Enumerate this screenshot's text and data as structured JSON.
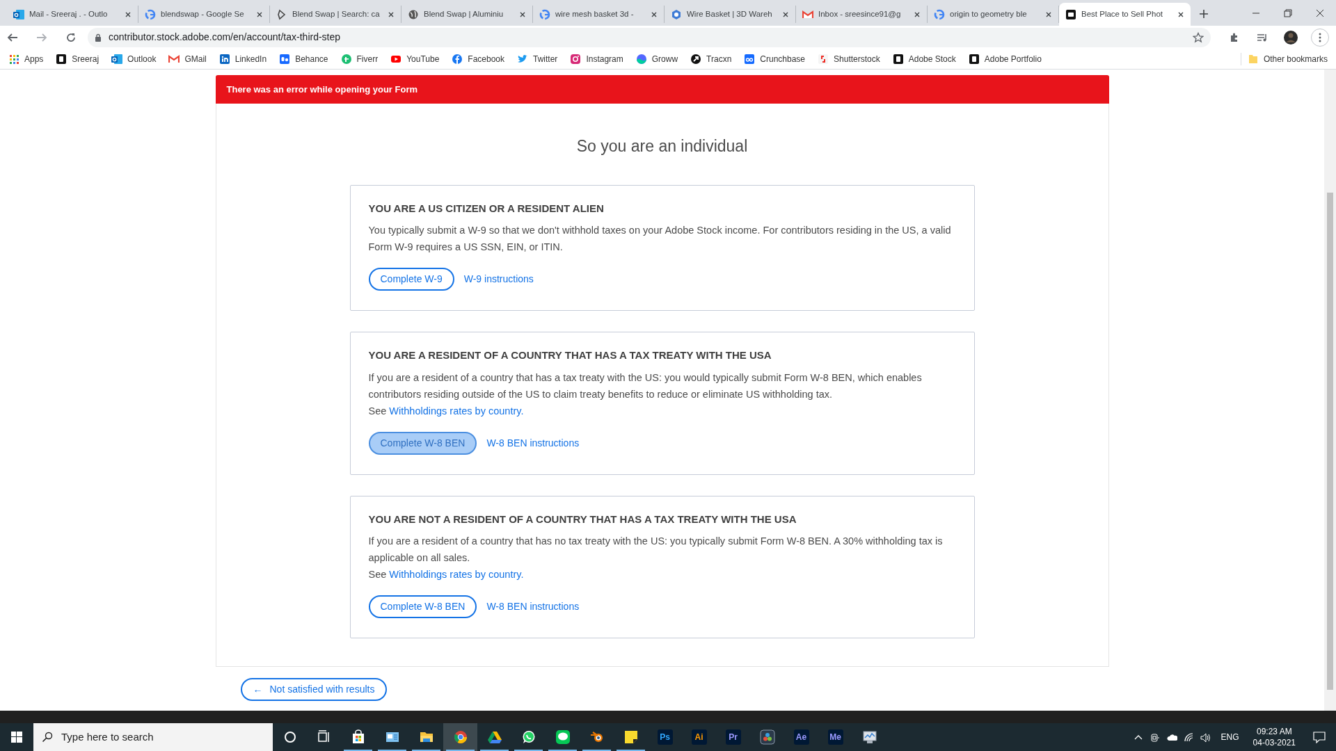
{
  "browser": {
    "tabs": [
      {
        "title": "Mail - Sreeraj . - Outlo",
        "selected": false
      },
      {
        "title": "blendswap - Google Se",
        "selected": false
      },
      {
        "title": "Blend Swap | Search: ca",
        "selected": false
      },
      {
        "title": "Blend Swap | Aluminiu",
        "selected": false
      },
      {
        "title": "wire mesh basket 3d -",
        "selected": false
      },
      {
        "title": "Wire Basket | 3D Wareh",
        "selected": false
      },
      {
        "title": "Inbox - sreesince91@g",
        "selected": false
      },
      {
        "title": "origin to geometry ble",
        "selected": false
      },
      {
        "title": "Best Place to Sell Phot",
        "selected": true
      }
    ],
    "url": "contributor.stock.adobe.com/en/account/tax-third-step",
    "bookmarks": [
      "Apps",
      "Sreeraj",
      "Outlook",
      "GMail",
      "LinkedIn",
      "Behance",
      "Fiverr",
      "YouTube",
      "Facebook",
      "Twitter",
      "Instagram",
      "Groww",
      "Tracxn",
      "Crunchbase",
      "Shutterstock",
      "Adobe Stock",
      "Adobe Portfolio"
    ],
    "other_bookmarks": "Other bookmarks"
  },
  "page": {
    "error": "There was an error while opening your Form",
    "heading": "So you are an individual",
    "options": [
      {
        "title": "YOU ARE A US CITIZEN OR A RESIDENT ALIEN",
        "body": "You typically submit a W-9 so that we don't withhold taxes on your Adobe Stock income. For contributors residing in the US, a valid Form W-9 requires a US SSN, EIN, or ITIN.",
        "button": {
          "label": "Complete W-9",
          "disabled": false
        },
        "link": "W-9 instructions"
      },
      {
        "title": "YOU ARE A RESIDENT OF A COUNTRY THAT HAS A TAX TREATY WITH THE USA",
        "body": "If you are a resident of a country that has a tax treaty with the US: you would typically submit Form W-8 BEN, which enables contributors residing outside of the US to claim treaty benefits to reduce or eliminate US withholding tax.",
        "see": "See",
        "see_link": "Withholdings rates by country.",
        "button": {
          "label": "Complete W-8 BEN",
          "disabled": true
        },
        "link": "W-8 BEN instructions"
      },
      {
        "title": "YOU ARE NOT A RESIDENT OF A COUNTRY THAT HAS A TAX TREATY WITH THE USA",
        "body": "If you are a resident of a country that has no tax treaty with the US: you typically submit Form W-8 BEN. A 30% withholding tax is applicable on all sales.",
        "see": "See",
        "see_link": "Withholdings rates by country.",
        "button": {
          "label": "Complete W-8 BEN",
          "disabled": false
        },
        "link": "W-8 BEN instructions"
      }
    ],
    "back_arrow": "←",
    "back_button": "Not satisfied with results"
  },
  "taskbar": {
    "search_placeholder": "Type here to search",
    "apps": [
      {
        "kind": "cortana",
        "running": false,
        "active": false
      },
      {
        "kind": "taskview",
        "running": false,
        "active": false
      },
      {
        "kind": "store",
        "running": true,
        "active": false
      },
      {
        "kind": "panel",
        "running": true,
        "active": false
      },
      {
        "kind": "folder",
        "running": true,
        "active": false
      },
      {
        "kind": "chrome",
        "running": true,
        "active": true
      },
      {
        "kind": "drive",
        "running": true,
        "active": false
      },
      {
        "kind": "whatsapp",
        "running": true,
        "active": false
      },
      {
        "kind": "line",
        "running": true,
        "active": false
      },
      {
        "kind": "blender",
        "running": true,
        "active": false
      },
      {
        "kind": "notes",
        "running": true,
        "active": false
      },
      {
        "kind": "lettered",
        "label": "Ps",
        "color": "#31a8ff",
        "running": false,
        "active": false
      },
      {
        "kind": "lettered",
        "label": "Ai",
        "color": "#ff9a00",
        "running": false,
        "active": false
      },
      {
        "kind": "lettered",
        "label": "Pr",
        "color": "#9999ff",
        "running": false,
        "active": false
      },
      {
        "kind": "resolve",
        "running": false,
        "active": false
      },
      {
        "kind": "lettered",
        "label": "Ae",
        "color": "#9999ff",
        "running": false,
        "active": false
      },
      {
        "kind": "lettered",
        "label": "Me",
        "color": "#9999ff",
        "running": false,
        "active": false
      },
      {
        "kind": "monitor",
        "running": false,
        "active": false
      }
    ],
    "language": "ENG",
    "time": "09:23 AM",
    "date": "04-03-2021"
  }
}
